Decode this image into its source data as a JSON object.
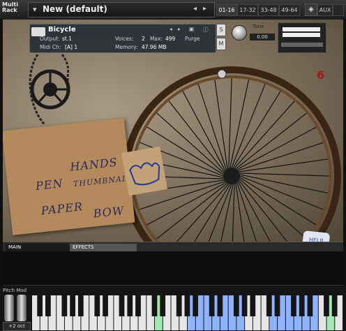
{
  "rack": {
    "label_line1": "Multi",
    "label_line2": "Rack",
    "preset_name": "New (default)",
    "arrow_left": "◂",
    "arrow_right": "▸"
  },
  "rack_tabs": [
    {
      "label": "01-16",
      "active": true
    },
    {
      "label": "17-32",
      "active": false
    },
    {
      "label": "33-48",
      "active": false
    },
    {
      "label": "49-64",
      "active": false
    }
  ],
  "aux_label": "AUX",
  "instrument": {
    "name": "Bicycle",
    "output_label": "Output:",
    "output_value": "st.1",
    "midi_label": "Midi Ch:",
    "midi_value": "[A] 1",
    "voices_label": "Voices:",
    "voices_value": "2",
    "max_label": "Max:",
    "max_value": "499",
    "purge_label": "Purge",
    "memory_label": "Memory:",
    "memory_value": "47.96 MB",
    "tune_label": "Tune",
    "tune_value": "0.00",
    "side_s": "S",
    "side_m": "M",
    "logo": "6"
  },
  "cardboard_words": [
    "PEN",
    "HANDS",
    "THUMBNAILS",
    "PAPER",
    "BOW"
  ],
  "help_label": "HELP",
  "tabs": {
    "main": "MAIN",
    "effects": "EFFECTS"
  },
  "keyboard": {
    "pitch_mod_label": "Pitch Mod",
    "octave_label": "+2 oct"
  },
  "colors": {
    "key_highlight_blue": "#8fb4ff",
    "key_highlight_green": "#9fe8b0",
    "accent": "#a01818"
  }
}
